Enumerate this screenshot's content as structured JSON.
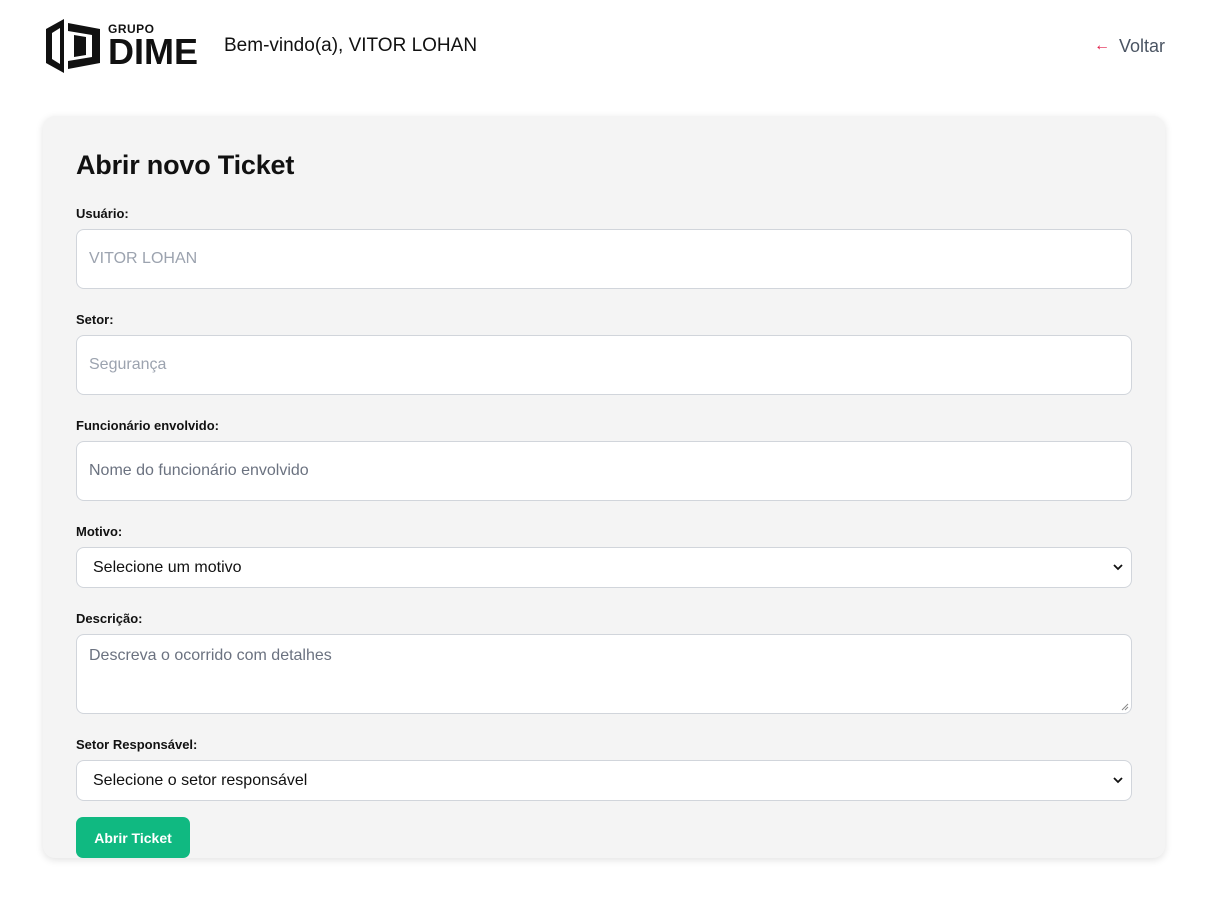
{
  "header": {
    "logo_small": "GRUPO",
    "logo_big": "DIME",
    "welcome": "Bem-vindo(a), VITOR LOHAN",
    "back_label": "Voltar",
    "back_arrow": "←"
  },
  "form": {
    "title": "Abrir novo Ticket",
    "usuario": {
      "label": "Usuário:",
      "value": "VITOR LOHAN"
    },
    "setor": {
      "label": "Setor:",
      "value": "Segurança"
    },
    "funcionario": {
      "label": "Funcionário envolvido:",
      "placeholder": "Nome do funcionário envolvido"
    },
    "motivo": {
      "label": "Motivo:",
      "selected": "Selecione um motivo"
    },
    "descricao": {
      "label": "Descrição:",
      "placeholder": "Descreva o ocorrido com detalhes"
    },
    "setor_responsavel": {
      "label": "Setor Responsável:",
      "selected": "Selecione o setor responsável"
    },
    "submit_label": "Abrir Ticket"
  },
  "colors": {
    "accent_button": "#10b981",
    "back_arrow": "#e11d48"
  }
}
